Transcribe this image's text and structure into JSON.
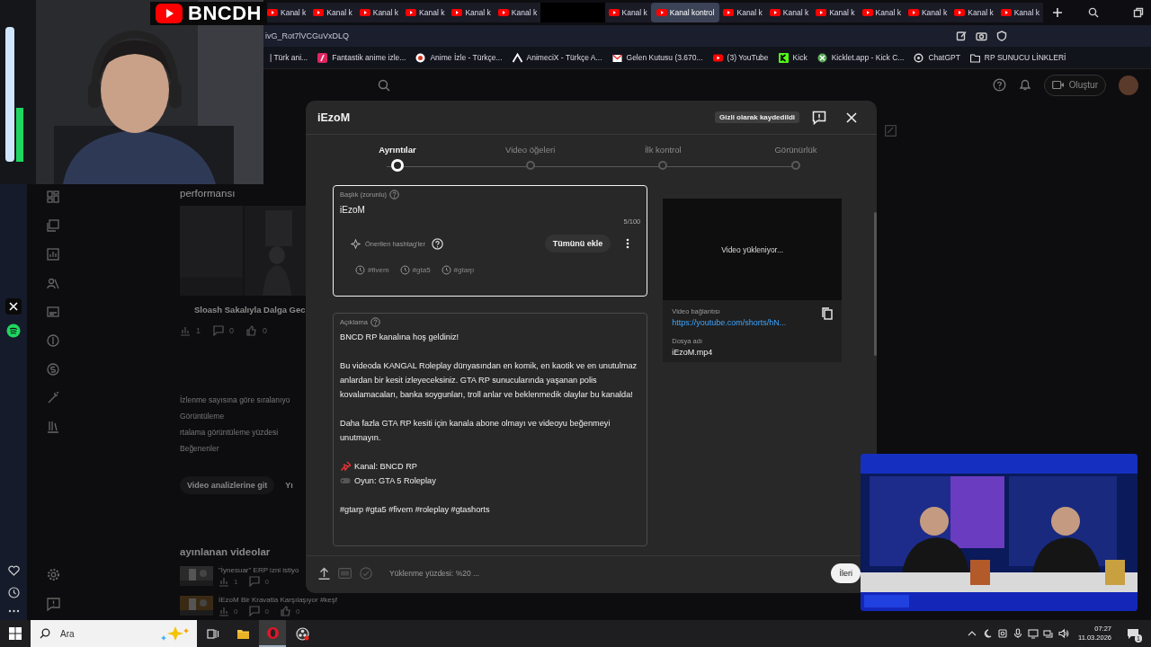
{
  "overlay_logo": {
    "text": "BNCDH"
  },
  "tabs": {
    "left": [
      {
        "label": "Kanal k",
        "selected": false
      },
      {
        "label": "Kanal k",
        "selected": false
      },
      {
        "label": "Kanal k",
        "selected": false
      },
      {
        "label": "Kanal k",
        "selected": false
      },
      {
        "label": "Kanal k",
        "selected": false
      },
      {
        "label": "Kanal k",
        "selected": false
      }
    ],
    "right": [
      {
        "label": "Kanal k",
        "selected": false
      },
      {
        "label": "Kanal kontrol",
        "selected": true
      },
      {
        "label": "Kanal k",
        "selected": false
      },
      {
        "label": "Kanal k",
        "selected": false
      },
      {
        "label": "Kanal k",
        "selected": false
      },
      {
        "label": "Kanal k",
        "selected": false
      },
      {
        "label": "Kanal k",
        "selected": false
      },
      {
        "label": "Kanal k",
        "selected": false
      },
      {
        "label": "Kanal k",
        "selected": false
      }
    ]
  },
  "address": {
    "url": "ivG_Rot7lVCGuVxDLQ"
  },
  "bookmarks": [
    {
      "kind": "page",
      "label": "| Türk ani..."
    },
    {
      "kind": "anime",
      "label": "Fantastik anime izle..."
    },
    {
      "kind": "circle",
      "label": "Anime İzle - Türkçe..."
    },
    {
      "kind": "triangle",
      "label": "AnimeciX - Türkçe A..."
    },
    {
      "kind": "mail",
      "label": "Gelen Kutusu (3.670..."
    },
    {
      "kind": "youtube",
      "label": "(3) YouTube"
    },
    {
      "kind": "kick",
      "label": "Kick"
    },
    {
      "kind": "kicklet",
      "label": "Kicklet.app - Kick C..."
    },
    {
      "kind": "chatgpt",
      "label": "ChatGPT"
    },
    {
      "kind": "folder",
      "label": "RP SUNUCU LİNKLERİ"
    }
  ],
  "studio": {
    "create_button": "Oluştur",
    "section_title": "performansı",
    "video_title": "Sloash Sakalıyla Dalga Gec",
    "stats": [
      "1",
      "0",
      "0"
    ],
    "sort_lines": [
      "İzlenme sayısına göre sıralanıyo",
      "Görüntüleme",
      "rtalama görüntüleme yüzdesi",
      "Beğenenler"
    ],
    "buttons": [
      "Video analizlerine git",
      "Yı"
    ],
    "published_title": "ayınlanan videolar",
    "published": [
      {
        "title": "\"İynesuar\" ERP izni istiyo",
        "stats": [
          "1",
          "0"
        ]
      },
      {
        "title": "İEzoM Bir Kravatla Karşılaşıyor #keşf",
        "stats": [
          "0",
          "0",
          "0"
        ]
      }
    ]
  },
  "dialog": {
    "title": "iEzoM",
    "status_badge": "Gizli olarak kaydedildi",
    "steps": [
      {
        "label": "Ayrıntılar",
        "selected": true
      },
      {
        "label": "Video öğeleri",
        "selected": false
      },
      {
        "label": "İlk kontrol",
        "selected": false
      },
      {
        "label": "Görünürlük",
        "selected": false
      }
    ],
    "title_field": {
      "label": "Başlık (zorunlu)",
      "value": "iEzoM",
      "counter": "5/100",
      "focused": true
    },
    "hashtags": {
      "label": "Önerilen hashtag'ler",
      "add_all": "Tümünü ekle",
      "items": [
        "#fivem",
        "#gta5",
        "#gtarp"
      ]
    },
    "description": {
      "label": "Açıklama",
      "lines": [
        {
          "kind": "text",
          "text": "BNCD RP kanalına hoş geldiniz!"
        },
        {
          "kind": "text",
          "text": "Bu videoda KANGAL Roleplay dünyasından en komik, en kaotik ve en unutulmaz anlardan bir kesit izleyeceksiniz. GTA RP sunucularında yaşanan polis kovalamacaları, banka soygunları, troll anlar ve beklenmedik olaylar bu kanalda!"
        },
        {
          "kind": "text",
          "text": "Daha fazla GTA RP kesiti için kanala abone olmayı ve videoyu beğenmeyi unutmayın."
        },
        {
          "kind": "pin",
          "text": "Kanal: BNCD RP"
        },
        {
          "kind": "gamepad",
          "text": "Oyun: GTA 5 Roleplay"
        },
        {
          "kind": "text",
          "text": "#gtarp #gta5 #fivem #roleplay #gtashorts"
        }
      ]
    },
    "preview": {
      "status": "Video yükleniyor...",
      "link_label": "Video bağlantısı",
      "link": "https://youtube.com/shorts/hN...",
      "file_label": "Dosya adı",
      "file": "iEzoM.mp4"
    },
    "footer": {
      "progress": "Yüklenme yüzdesi: %20 ...",
      "next": "İleri"
    }
  },
  "taskbar": {
    "search": "Ara",
    "apps": [
      {
        "kind": "taskview",
        "active": false
      },
      {
        "kind": "folder",
        "active": false
      },
      {
        "kind": "opera",
        "active": true
      },
      {
        "kind": "obs",
        "active": false
      }
    ],
    "time": "07:27",
    "date": "11.03.2026",
    "notifications": "1"
  }
}
